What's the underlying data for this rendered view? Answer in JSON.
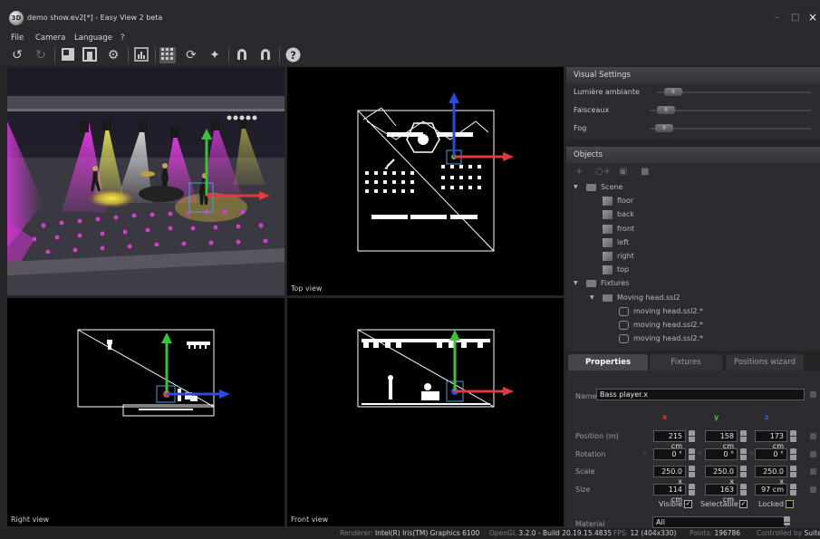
{
  "window": {
    "title": "demo show.ev2[*] - Easy View 2 beta",
    "logo_text": "3D",
    "minimize_glyph": "–",
    "maximize_glyph": "□",
    "close_glyph": "×"
  },
  "menu": [
    "File",
    "Camera",
    "Language",
    "?"
  ],
  "toolbar": {
    "icons": [
      "undo-icon",
      "redo-icon",
      "fullscreen-icon",
      "layout-icon",
      "settings-gear-icon",
      "chart-icon",
      "grid-icon",
      "rotate-icon",
      "move-icon",
      "magnet-icon",
      "magnet-2-icon",
      "help-icon"
    ]
  },
  "viewports": {
    "perspective": {
      "label": ""
    },
    "top": {
      "label": "Top view"
    },
    "right": {
      "label": "Right view"
    },
    "front": {
      "label": "Front view"
    }
  },
  "visual_settings": {
    "header": "Visual Settings",
    "items": [
      {
        "label": "Lumière ambiante",
        "knob": "II"
      },
      {
        "label": "Faisceaux",
        "knob": "II"
      },
      {
        "label": "Fog",
        "knob": "II"
      }
    ]
  },
  "objects": {
    "header": "Objects",
    "tools": [
      "add-icon",
      "add-fixture-icon",
      "folder-add-icon",
      "delete-icon"
    ],
    "tree": [
      {
        "label": "Scene",
        "icon": "folder",
        "level": 0,
        "expanded": true
      },
      {
        "label": "floor",
        "icon": "cube",
        "level": 1
      },
      {
        "label": "back",
        "icon": "cube",
        "level": 1
      },
      {
        "label": "front",
        "icon": "cube",
        "level": 1
      },
      {
        "label": "left",
        "icon": "cube",
        "level": 1
      },
      {
        "label": "right",
        "icon": "cube",
        "level": 1
      },
      {
        "label": "top",
        "icon": "cube",
        "level": 1
      },
      {
        "label": "Fixtures",
        "icon": "folder",
        "level": 0,
        "expanded": true
      },
      {
        "label": "Moving head.ssl2",
        "icon": "folder",
        "level": 1,
        "expanded": true
      },
      {
        "label": "moving head.ssl2.*",
        "icon": "head",
        "level": 2
      },
      {
        "label": "moving head.ssl2.*",
        "icon": "head",
        "level": 2
      },
      {
        "label": "moving head.ssl2.*",
        "icon": "head",
        "level": 2
      }
    ]
  },
  "tabs": [
    {
      "label": "Properties",
      "active": true
    },
    {
      "label": "Fixtures",
      "active": false
    },
    {
      "label": "Positions wizard",
      "active": false
    }
  ],
  "properties": {
    "name_label": "Name",
    "name_value": "Bass player.x",
    "axes": [
      {
        "letter": "x",
        "color": "#e03a3a"
      },
      {
        "letter": "y",
        "color": "#3ec03e"
      },
      {
        "letter": "z",
        "color": "#3a5ae0"
      }
    ],
    "rows": [
      {
        "label": "Position (m)",
        "values": [
          "215 cm",
          "158 cm",
          "173 cm"
        ]
      },
      {
        "label": "Rotation",
        "values": [
          "0 °",
          "0 °",
          "0 °"
        ]
      },
      {
        "label": "Scale",
        "values": [
          "250.0 x",
          "250.0 x",
          "250.0 x"
        ]
      },
      {
        "label": "Size",
        "values": [
          "114 cm",
          "163 cm",
          "97 cm"
        ]
      }
    ],
    "flags": [
      {
        "label": "Visible",
        "checked": true
      },
      {
        "label": "Selectable",
        "checked": true
      },
      {
        "label": "Locked",
        "checked": false
      }
    ],
    "material_label": "Material",
    "material_value": "All"
  },
  "status": {
    "renderer_label": "Renderer:",
    "renderer_value": "Intel(R) Iris(TM) Graphics 6100",
    "opengl_label": "OpenGL",
    "opengl_value": "3.2.0 - Build 20.19.15.4835",
    "fps_label": "FPS:",
    "fps_value": "12 (404x330)",
    "points_label": "Points:",
    "points_value": "196786",
    "controlled_label": "Controlled by",
    "controlled_value": "Suite"
  }
}
